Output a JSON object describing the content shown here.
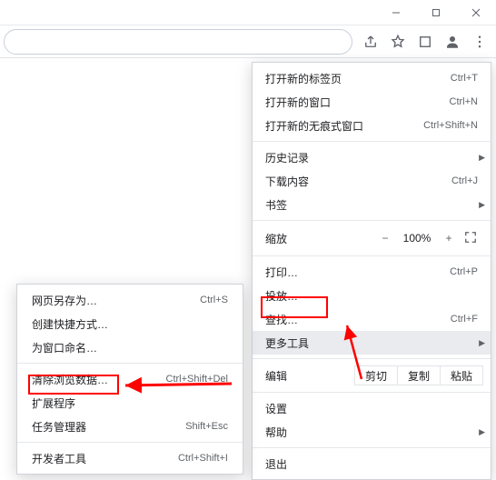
{
  "window": {
    "minimize": "–",
    "maximize": "▢",
    "close": "✕"
  },
  "toolbar": {
    "share_icon": "share",
    "star_icon": "star",
    "extensions_icon": "extensions",
    "profile_icon": "profile",
    "menu_icon": "menu"
  },
  "main_menu": {
    "new_tab": {
      "label": "打开新的标签页",
      "shortcut": "Ctrl+T"
    },
    "new_window": {
      "label": "打开新的窗口",
      "shortcut": "Ctrl+N"
    },
    "incognito": {
      "label": "打开新的无痕式窗口",
      "shortcut": "Ctrl+Shift+N"
    },
    "history": {
      "label": "历史记录"
    },
    "downloads": {
      "label": "下载内容",
      "shortcut": "Ctrl+J"
    },
    "bookmarks": {
      "label": "书签"
    },
    "zoom": {
      "label": "缩放",
      "minus": "−",
      "pct": "100%",
      "plus": "+"
    },
    "print": {
      "label": "打印…",
      "shortcut": "Ctrl+P"
    },
    "cast": {
      "label": "投放…"
    },
    "find": {
      "label": "查找…",
      "shortcut": "Ctrl+F"
    },
    "more_tools": {
      "label": "更多工具"
    },
    "edit": {
      "label": "编辑",
      "cut": "剪切",
      "copy": "复制",
      "paste": "粘贴"
    },
    "settings": {
      "label": "设置"
    },
    "help": {
      "label": "帮助"
    },
    "exit": {
      "label": "退出"
    }
  },
  "submenu": {
    "save_as": {
      "label": "网页另存为…",
      "shortcut": "Ctrl+S"
    },
    "create_shortcut": {
      "label": "创建快捷方式…"
    },
    "name_window": {
      "label": "为窗口命名…"
    },
    "clear_browsing_data": {
      "label": "清除浏览数据…",
      "shortcut": "Ctrl+Shift+Del"
    },
    "extensions": {
      "label": "扩展程序"
    },
    "task_manager": {
      "label": "任务管理器",
      "shortcut": "Shift+Esc"
    },
    "dev_tools": {
      "label": "开发者工具",
      "shortcut": "Ctrl+Shift+I"
    }
  }
}
